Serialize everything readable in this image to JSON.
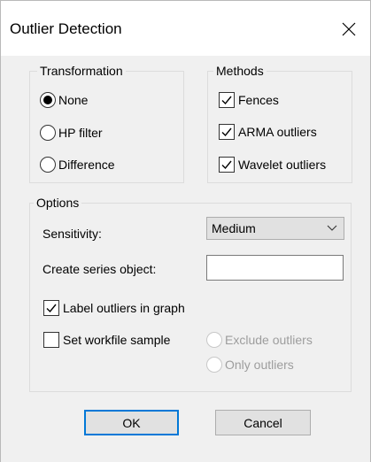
{
  "dialog": {
    "title": "Outlier Detection"
  },
  "transformation": {
    "label": "Transformation",
    "options": [
      {
        "label": "None",
        "selected": true
      },
      {
        "label": "HP filter",
        "selected": false
      },
      {
        "label": "Difference",
        "selected": false
      }
    ]
  },
  "methods": {
    "label": "Methods",
    "items": [
      {
        "label": "Fences",
        "checked": true
      },
      {
        "label": "ARMA outliers",
        "checked": true
      },
      {
        "label": "Wavelet outliers",
        "checked": true
      }
    ]
  },
  "options": {
    "label": "Options",
    "sensitivity_label": "Sensitivity:",
    "sensitivity_value": "Medium",
    "create_series_label": "Create series object:",
    "create_series_value": "",
    "label_outliers": {
      "label": "Label outliers in graph",
      "checked": true
    },
    "set_workfile": {
      "label": "Set workfile sample",
      "checked": false
    },
    "sample_options": [
      {
        "label": "Exclude outliers",
        "selected": false,
        "enabled": false
      },
      {
        "label": "Only outliers",
        "selected": false,
        "enabled": false
      }
    ]
  },
  "buttons": {
    "ok": "OK",
    "cancel": "Cancel"
  },
  "colors": {
    "accent": "#0078d7",
    "client_bg": "#f0f0f0",
    "button_bg": "#e1e1e1"
  }
}
